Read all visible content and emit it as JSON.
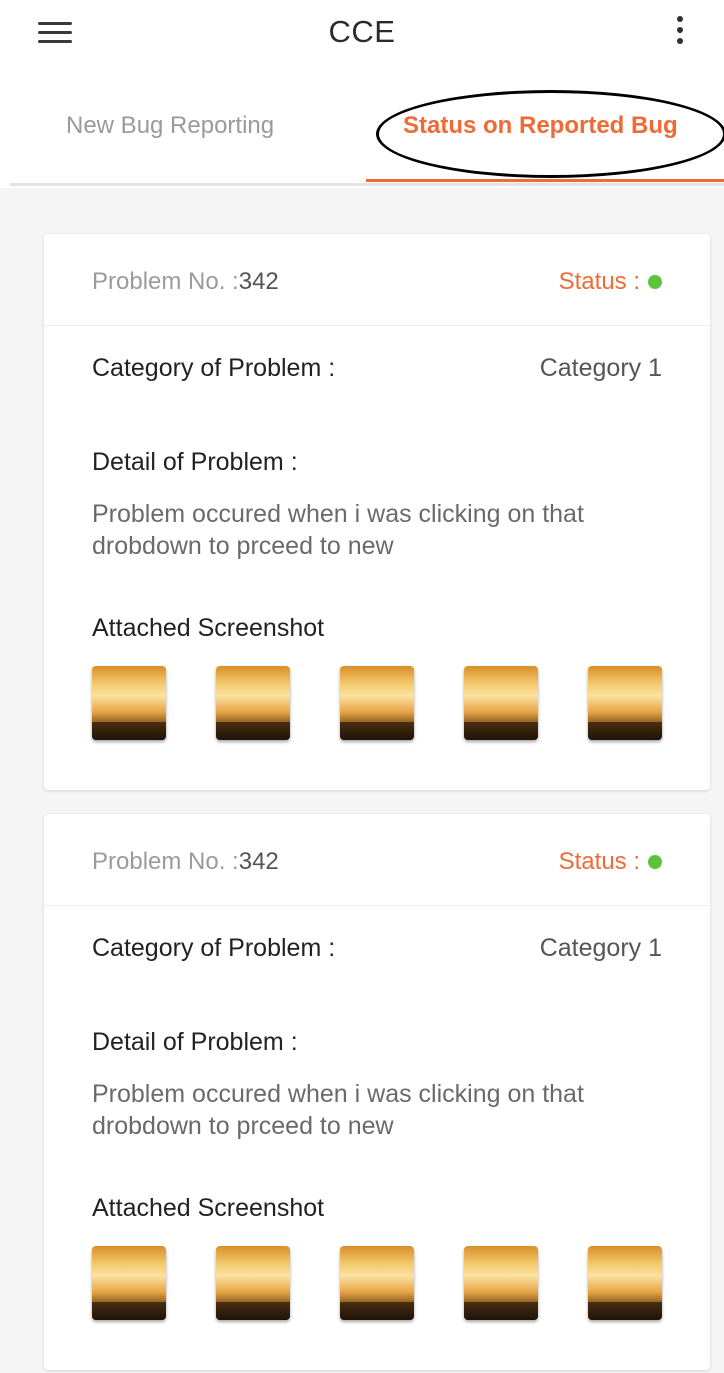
{
  "appbar": {
    "title": "CCE",
    "menu_icon": "hamburger-menu-icon",
    "more_icon": "more-vert-icon"
  },
  "tabs": [
    {
      "label": "New Bug Reporting",
      "active": false
    },
    {
      "label": "Status on Reported Bug",
      "active": true
    }
  ],
  "colors": {
    "accent": "#f06a35",
    "status_ok": "#5cc43b"
  },
  "reports": [
    {
      "problem_label": "Problem No. :",
      "problem_no": "342",
      "status_label": "Status :",
      "category_label": "Category of Problem :",
      "category_value": "Category 1",
      "detail_label": "Detail of Problem :",
      "detail_text": "Problem occured when i was clicking on that drobdown to prceed to new",
      "screenshot_label": "Attached Screenshot",
      "screenshot_count": 5
    },
    {
      "problem_label": "Problem No. :",
      "problem_no": "342",
      "status_label": "Status :",
      "category_label": "Category of Problem :",
      "category_value": "Category 1",
      "detail_label": "Detail of Problem :",
      "detail_text": "Problem occured when i was clicking on that drobdown to prceed to new",
      "screenshot_label": "Attached Screenshot",
      "screenshot_count": 5
    }
  ]
}
